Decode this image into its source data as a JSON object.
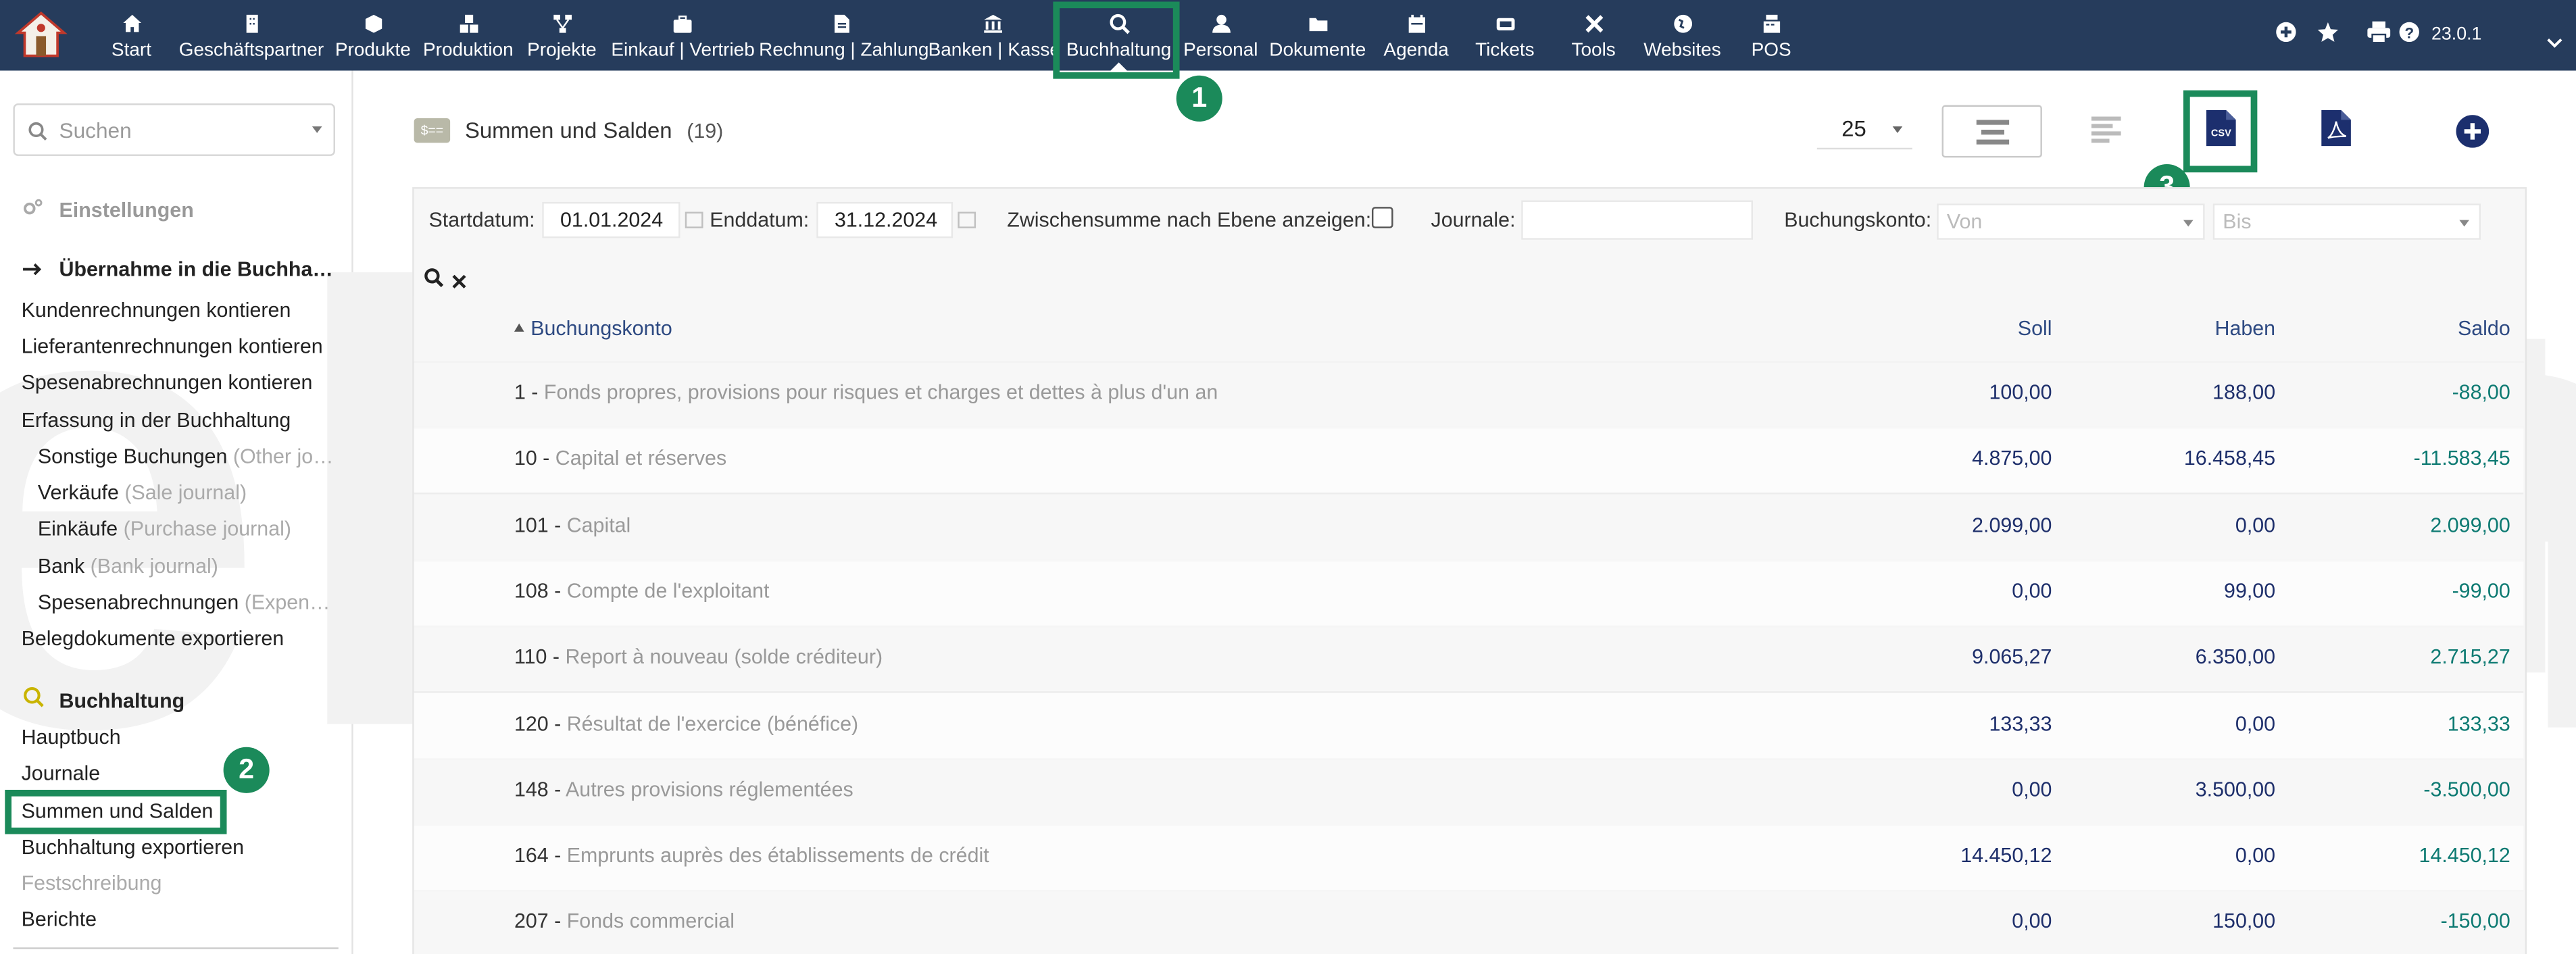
{
  "topbar": {
    "nav": [
      {
        "label": "Start",
        "icon": "home-icon"
      },
      {
        "label": "Geschäftspartner",
        "icon": "building-icon"
      },
      {
        "label": "Produkte",
        "icon": "cube-icon"
      },
      {
        "label": "Produktion",
        "icon": "cubes-icon"
      },
      {
        "label": "Projekte",
        "icon": "project-diagram-icon"
      },
      {
        "label": "Einkauf | Vertrieb",
        "icon": "briefcase-icon"
      },
      {
        "label": "Rechnung | Zahlung",
        "icon": "invoice-icon"
      },
      {
        "label": "Banken | Kasse",
        "icon": "bank-icon"
      },
      {
        "label": "Buchhaltung",
        "icon": "search-dollar-icon"
      },
      {
        "label": "Personal",
        "icon": "user-icon"
      },
      {
        "label": "Dokumente",
        "icon": "folder-icon"
      },
      {
        "label": "Agenda",
        "icon": "calendar-icon"
      },
      {
        "label": "Tickets",
        "icon": "ticket-icon"
      },
      {
        "label": "Tools",
        "icon": "tools-icon"
      },
      {
        "label": "Websites",
        "icon": "globe-icon"
      },
      {
        "label": "POS",
        "icon": "cash-register-icon"
      }
    ],
    "active": "Buchhaltung",
    "version": "23.0.1"
  },
  "annotations": [
    "1",
    "2",
    "3"
  ],
  "sidebar": {
    "search_placeholder": "Suchen",
    "settings": "Einstellungen",
    "section1_title": "Übernahme in die Buchha…",
    "section1_items": [
      "Kundenrechnungen kontieren",
      "Lieferantenrechnungen kontieren",
      "Spesenabrechnungen kontieren",
      "Erfassung in der Buchhaltung"
    ],
    "journals": [
      {
        "name": "Sonstige Buchungen",
        "hint": "(Other jo…"
      },
      {
        "name": "Verkäufe",
        "hint": "(Sale journal)"
      },
      {
        "name": "Einkäufe",
        "hint": "(Purchase journal)"
      },
      {
        "name": "Bank",
        "hint": "(Bank journal)"
      },
      {
        "name": "Spesenabrechnungen",
        "hint": "(Expen…"
      }
    ],
    "export_docs": "Belegdokumente exportieren",
    "section2_title": "Buchhaltung",
    "section2_items": [
      "Hauptbuch",
      "Journale",
      "Summen und Salden",
      "Buchhaltung exportieren",
      "Festschreibung",
      "Berichte"
    ]
  },
  "watermark": "eBilanz+",
  "page": {
    "title": "Summen und Salden",
    "count": "(19)",
    "page_size": "25",
    "csv_label": "CSV"
  },
  "filters": {
    "start_label": "Startdatum:",
    "start_value": "01.01.2024",
    "end_label": "Enddatum:",
    "end_value": "31.12.2024",
    "subtotal_label": "Zwischensumme nach Ebene anzeigen:",
    "journals_label": "Journale:",
    "account_label": "Buchungskonto:",
    "from_placeholder": "Von",
    "to_placeholder": "Bis"
  },
  "table": {
    "columns": {
      "account": "Buchungskonto",
      "debit": "Soll",
      "credit": "Haben",
      "balance": "Saldo"
    },
    "rows": [
      {
        "code": "1 -",
        "name": "Fonds propres, provisions pour risques et charges et dettes à plus d'un an",
        "soll": "100,00",
        "haben": "188,00",
        "saldo": "-88,00"
      },
      {
        "code": "10 -",
        "name": "Capital et réserves",
        "soll": "4.875,00",
        "haben": "16.458,45",
        "saldo": "-11.583,45"
      },
      {
        "code": "101 -",
        "name": "Capital",
        "soll": "2.099,00",
        "haben": "0,00",
        "saldo": "2.099,00"
      },
      {
        "code": "108 -",
        "name": "Compte de l'exploitant",
        "soll": "0,00",
        "haben": "99,00",
        "saldo": "-99,00"
      },
      {
        "code": "110 -",
        "name": "Report à nouveau (solde créditeur)",
        "soll": "9.065,27",
        "haben": "6.350,00",
        "saldo": "2.715,27"
      },
      {
        "code": "120 -",
        "name": "Résultat de l'exercice (bénéfice)",
        "soll": "133,33",
        "haben": "0,00",
        "saldo": "133,33"
      },
      {
        "code": "148 -",
        "name": "Autres provisions réglementées",
        "soll": "0,00",
        "haben": "3.500,00",
        "saldo": "-3.500,00"
      },
      {
        "code": "164 -",
        "name": "Emprunts auprès des établissements de crédit",
        "soll": "14.450,12",
        "haben": "0,00",
        "saldo": "14.450,12"
      },
      {
        "code": "207 -",
        "name": "Fonds commercial",
        "soll": "0,00",
        "haben": "150,00",
        "saldo": "-150,00"
      }
    ]
  },
  "colors": {
    "topbar": "#263c5c",
    "highlight": "#1b8a5a",
    "link": "#2e4a82",
    "saldo": "#0d7a72",
    "amount": "#1e2f6b"
  }
}
